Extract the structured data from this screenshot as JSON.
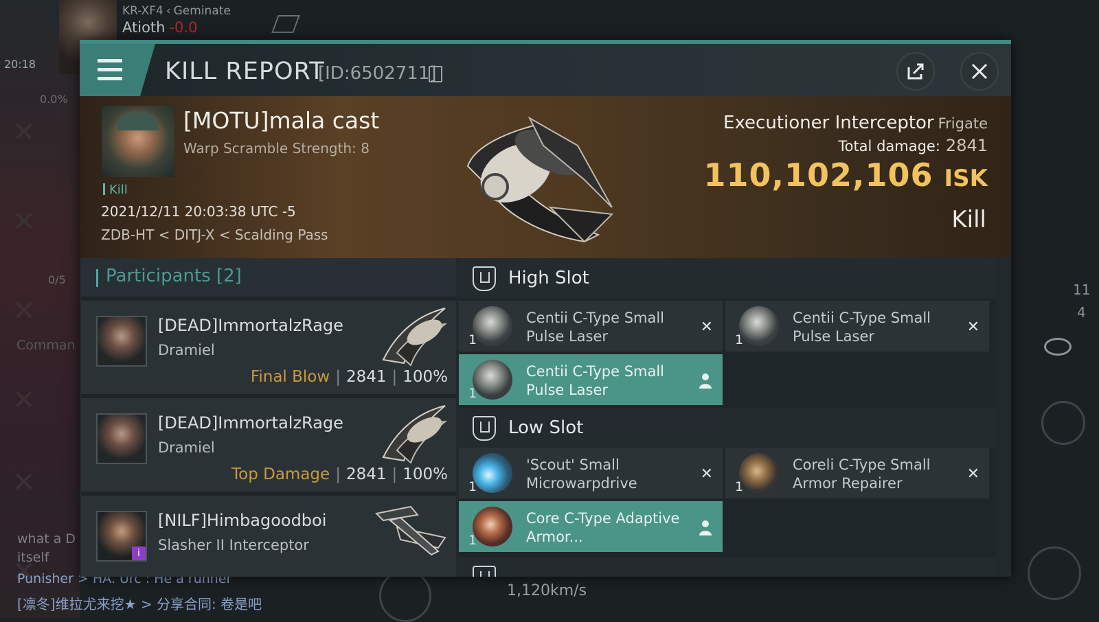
{
  "background": {
    "system": "KR-XF4",
    "system_ref": "Geminate",
    "system_name": "Atioth",
    "security": "-0.0",
    "clock": "20:18",
    "cargo_pct": "0.0%",
    "command_label": "Comman",
    "chat_line1": "what a D itself",
    "chat_line2": "Punisher > HA. Urc : He a runner",
    "chat_line3": "[凛冬]维拉尤来挖★ > 分享合同: 卷是吧",
    "speed": "1,120km/s",
    "count_a": "11",
    "count_b": "4",
    "num_label": "0/5"
  },
  "header": {
    "title": "KILL REPORT",
    "id": "[ID:6502711]"
  },
  "victim": {
    "name": "[MOTU]mala cast",
    "subtitle": "Warp Scramble Strength: 8",
    "tag": "Kill",
    "datetime": "2021/12/11 20:03:38 UTC -5",
    "location": "ZDB-HT < DITJ-X < Scalding Pass",
    "ship": "Executioner Interceptor",
    "ship_class": "Frigate",
    "damage_label": "Total damage:",
    "damage_value": "2841",
    "isk_value": "110,102,106",
    "isk_unit": "ISK",
    "result": "Kill"
  },
  "participants": {
    "title": "Participants [2]",
    "rows": [
      {
        "name": "[DEAD]ImmortalzRage",
        "ship": "Dramiel",
        "role": "Final Blow",
        "damage": "2841",
        "percent": "100%"
      },
      {
        "name": "[DEAD]ImmortalzRage",
        "ship": "Dramiel",
        "role": "Top Damage",
        "damage": "2841",
        "percent": "100%"
      },
      {
        "name": "[NILF]Himbagoodboi",
        "ship": "Slasher II Interceptor",
        "role": "",
        "damage": "",
        "percent": ""
      }
    ]
  },
  "fitting": {
    "high_slot_title": "High Slot",
    "low_slot_title": "Low Slot",
    "high": [
      {
        "name": "Centii C-Type Small Pulse Laser",
        "qty": "1",
        "state": "destroyed"
      },
      {
        "name": "Centii C-Type Small Pulse Laser",
        "qty": "1",
        "state": "destroyed"
      },
      {
        "name": "Centii C-Type Small Pulse Laser",
        "qty": "1",
        "state": "dropped"
      }
    ],
    "low": [
      {
        "name": "'Scout' Small Microwarpdrive",
        "qty": "1",
        "state": "destroyed"
      },
      {
        "name": "Coreli C-Type Small Armor Repairer",
        "qty": "1",
        "state": "destroyed"
      },
      {
        "name": "Core C-Type Adaptive Armor...",
        "qty": "1",
        "state": "dropped"
      }
    ]
  },
  "colors": {
    "accent": "#3f8a83",
    "fitted_bg": "#4b9488",
    "isk": "#f2c25e",
    "role": "#c79a3b"
  },
  "icons": [
    "menu-icon",
    "copy-icon",
    "share-icon",
    "close-icon",
    "slot-shield-icon",
    "destroyed-x-icon",
    "dropped-pilot-icon"
  ]
}
